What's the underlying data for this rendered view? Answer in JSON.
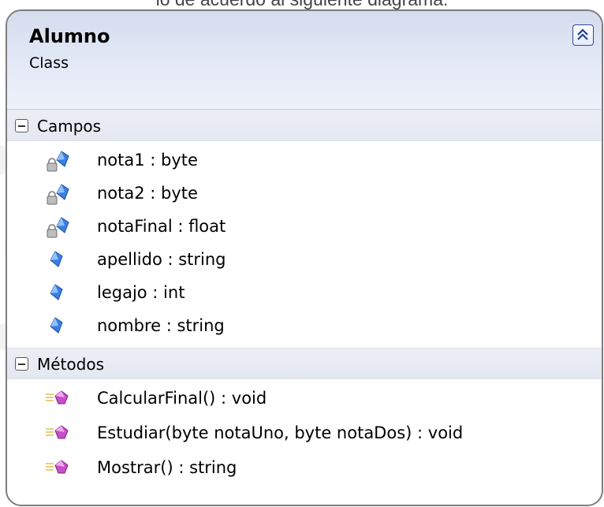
{
  "caption": "lo de acuerdo al siguiente diagrama:",
  "class_box": {
    "name": "Alumno",
    "kind": "Class",
    "collapse_icon": "double-chevron-up-icon"
  },
  "fields_section": {
    "title": "Campos",
    "toggle_icon": "collapse-minus-icon",
    "items": [
      {
        "text": "nota1 : byte",
        "icon": "private-field-icon"
      },
      {
        "text": "nota2 : byte",
        "icon": "private-field-icon"
      },
      {
        "text": "notaFinal : float",
        "icon": "private-field-icon"
      },
      {
        "text": "apellido : string",
        "icon": "public-field-icon"
      },
      {
        "text": "legajo : int",
        "icon": "public-field-icon"
      },
      {
        "text": "nombre : string",
        "icon": "public-field-icon"
      }
    ]
  },
  "methods_section": {
    "title": "Métodos",
    "toggle_icon": "collapse-minus-icon",
    "items": [
      {
        "text": "CalcularFinal() : void",
        "icon": "public-method-icon"
      },
      {
        "text": "Estudiar(byte notaUno, byte notaDos) : void",
        "icon": "public-method-icon"
      },
      {
        "text": "Mostrar() : string",
        "icon": "public-method-icon"
      }
    ]
  },
  "colors": {
    "header_gradient_top": "#d4dcee",
    "border": "#7d7d7d",
    "field_icon_blue": "#3a7fe0",
    "method_icon_magenta": "#c84fc8",
    "lock_gray": "#8c8c8c"
  }
}
